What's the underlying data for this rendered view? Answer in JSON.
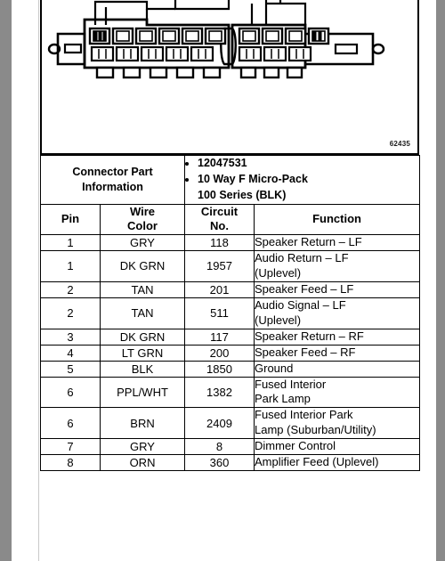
{
  "figure": {
    "number": "62435",
    "connector_name": "10 Way F Micro-Pack 100 Series connector illustration",
    "left_cavities": 6,
    "right_cavities": 4
  },
  "connector_part_information": {
    "label": "Connector Part\nInformation",
    "label_line1": "Connector Part",
    "label_line2": "Information",
    "items": [
      "12047531",
      "10 Way F Micro-Pack 100 Series (BLK)"
    ],
    "item_2_line1": "10 Way F Micro-Pack",
    "item_2_line2": "100 Series (BLK)"
  },
  "table": {
    "headers": {
      "pin": "Pin",
      "wire_color_line1": "Wire",
      "wire_color_line2": "Color",
      "circuit_line1": "Circuit",
      "circuit_line2": "No.",
      "function": "Function"
    },
    "rows": [
      {
        "pin": "1",
        "wire_color": "GRY",
        "circuit_no": "118",
        "function_line1": "Speaker Return – LF",
        "function_line2": ""
      },
      {
        "pin": "1",
        "wire_color": "DK GRN",
        "circuit_no": "1957",
        "function_line1": "Audio Return – LF",
        "function_line2": "(Uplevel)"
      },
      {
        "pin": "2",
        "wire_color": "TAN",
        "circuit_no": "201",
        "function_line1": "Speaker Feed – LF",
        "function_line2": ""
      },
      {
        "pin": "2",
        "wire_color": "TAN",
        "circuit_no": "511",
        "function_line1": "Audio Signal – LF",
        "function_line2": "(Uplevel)"
      },
      {
        "pin": "3",
        "wire_color": "DK GRN",
        "circuit_no": "117",
        "function_line1": "Speaker Return – RF",
        "function_line2": ""
      },
      {
        "pin": "4",
        "wire_color": "LT GRN",
        "circuit_no": "200",
        "function_line1": "Speaker Feed – RF",
        "function_line2": ""
      },
      {
        "pin": "5",
        "wire_color": "BLK",
        "circuit_no": "1850",
        "function_line1": "Ground",
        "function_line2": ""
      },
      {
        "pin": "6",
        "wire_color": "PPL/WHT",
        "circuit_no": "1382",
        "function_line1": "Fused Interior",
        "function_line2": "Park Lamp"
      },
      {
        "pin": "6",
        "wire_color": "BRN",
        "circuit_no": "2409",
        "function_line1": "Fused Interior Park",
        "function_line2": "Lamp (Suburban/Utility)"
      },
      {
        "pin": "7",
        "wire_color": "GRY",
        "circuit_no": "8",
        "function_line1": "Dimmer Control",
        "function_line2": ""
      },
      {
        "pin": "8",
        "wire_color": "ORN",
        "circuit_no": "360",
        "function_line1": "Amplifier Feed (Uplevel)",
        "function_line2": ""
      }
    ]
  },
  "colors": {
    "page_background": "#ffffff",
    "outer_margin": "#8a8a8a",
    "ink": "#000000",
    "gutter_rule": "#c9c9c9"
  }
}
